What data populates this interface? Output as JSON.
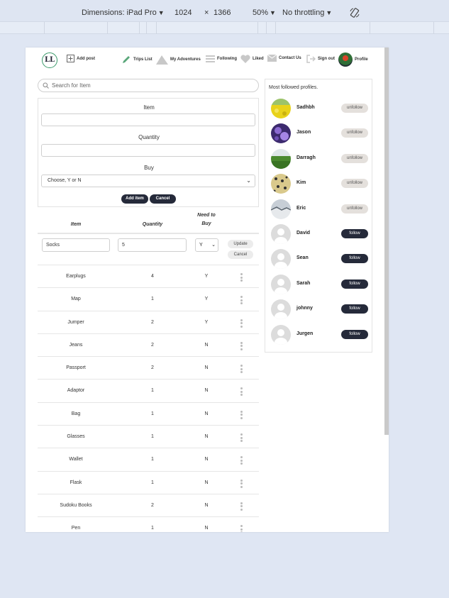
{
  "devtools": {
    "dimensions_label": "Dimensions: iPad Pro",
    "width": "1024",
    "times": "×",
    "height": "1366",
    "zoom": "50%",
    "throttling": "No throttling",
    "icons": [
      "caret-down-icon",
      "rotate-icon"
    ]
  },
  "nav": {
    "logo": "LL",
    "add_post": "Add post",
    "trips_list": "Trips List",
    "my_adventures": "My Adventures",
    "following": "Following",
    "liked": "Liked",
    "contact_us": "Contact Us",
    "sign_out": "Sign out",
    "profile": "Profile"
  },
  "search": {
    "placeholder": "Search for Item"
  },
  "form": {
    "item_label": "Item",
    "quantity_label": "Quantity",
    "buy_label": "Buy",
    "buy_select": "Choose, Y or N",
    "add_button": "Add item",
    "cancel_button": "Cancel"
  },
  "table": {
    "headers": {
      "item": "Item",
      "quantity": "Quantity",
      "need_line1": "Need to",
      "need_line2": "Buy"
    },
    "edit_row": {
      "item": "Socks",
      "quantity": "5",
      "buy": "Y",
      "update": "Update",
      "cancel": "Cancel"
    },
    "rows": [
      {
        "item": "Earplugs",
        "qty": "4",
        "buy": "Y"
      },
      {
        "item": "Map",
        "qty": "1",
        "buy": "Y"
      },
      {
        "item": "Jumper",
        "qty": "2",
        "buy": "Y"
      },
      {
        "item": "Jeans",
        "qty": "2",
        "buy": "N"
      },
      {
        "item": "Passport",
        "qty": "2",
        "buy": "N"
      },
      {
        "item": "Adaptor",
        "qty": "1",
        "buy": "N"
      },
      {
        "item": "Bag",
        "qty": "1",
        "buy": "N"
      },
      {
        "item": "Glasses",
        "qty": "1",
        "buy": "N"
      },
      {
        "item": "Wallet",
        "qty": "1",
        "buy": "N"
      },
      {
        "item": "Flask",
        "qty": "1",
        "buy": "N"
      },
      {
        "item": "Sudoku Books",
        "qty": "2",
        "buy": "N"
      },
      {
        "item": "Pen",
        "qty": "1",
        "buy": "N"
      }
    ]
  },
  "profiles": {
    "title": "Most followed profiles.",
    "unfollow_label": "unfollow",
    "follow_label": "follow",
    "list": [
      {
        "name": "Sadhbh",
        "button": "unfollow",
        "pic": "yellow-flowers"
      },
      {
        "name": "Jason",
        "button": "unfollow",
        "pic": "purple-flowers"
      },
      {
        "name": "Darragh",
        "button": "unfollow",
        "pic": "green-field"
      },
      {
        "name": "Kim",
        "button": "unfollow",
        "pic": "leopard"
      },
      {
        "name": "Eric",
        "button": "unfollow",
        "pic": "snowy-landscape"
      },
      {
        "name": "David",
        "button": "follow",
        "pic": "default-avatar"
      },
      {
        "name": "Sean",
        "button": "follow",
        "pic": "default-avatar"
      },
      {
        "name": "Sarah",
        "button": "follow",
        "pic": "default-avatar"
      },
      {
        "name": "johnny",
        "button": "follow",
        "pic": "default-avatar"
      },
      {
        "name": "Jurgen",
        "button": "follow",
        "pic": "default-avatar"
      }
    ]
  },
  "colors": {
    "dark_button": "#252a3a",
    "unfollow_bg": "#e4e0dc",
    "logo_ring": "#3a9a6a"
  }
}
